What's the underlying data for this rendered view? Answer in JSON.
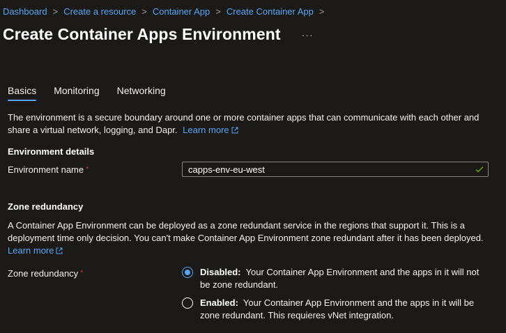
{
  "breadcrumb": {
    "items": [
      "Dashboard",
      "Create a resource",
      "Container App",
      "Create Container App"
    ],
    "separator": ">"
  },
  "page": {
    "title": "Create Container Apps Environment",
    "more_label": "···"
  },
  "tabs": [
    {
      "label": "Basics",
      "active": true
    },
    {
      "label": "Monitoring",
      "active": false
    },
    {
      "label": "Networking",
      "active": false
    }
  ],
  "intro": {
    "text": "The environment is a secure boundary around one or more container apps that can communicate with each other and share a virtual network, logging, and Dapr.",
    "link_label": "Learn more"
  },
  "environment_details": {
    "heading": "Environment details",
    "name_label": "Environment name",
    "required_marker": "*",
    "name_value": "capps-env-eu-west"
  },
  "zone_redundancy": {
    "heading": "Zone redundancy",
    "description": "A Container App Environment can be deployed as a zone redundant service in the regions that support it. This is a deployment time only decision. You can't make Container App Environment zone redundant after it has been deployed.",
    "link_label": "Learn more",
    "field_label": "Zone redundancy",
    "required_marker": "*",
    "options": [
      {
        "title": "Disabled:",
        "description": "Your Container App Environment and the apps in it will not be zone redundant.",
        "selected": true
      },
      {
        "title": "Enabled:",
        "description": "Your Container App Environment and the apps in it will be zone redundant. This requieres vNet integration.",
        "selected": false
      }
    ]
  },
  "colors": {
    "background": "#1b1a19",
    "link": "#5aa6f5",
    "required": "#d13438",
    "success_check": "#6bb700"
  },
  "icons": {
    "external_link": "external-link-icon",
    "valid": "checkmark-icon",
    "more": "more-icon"
  }
}
